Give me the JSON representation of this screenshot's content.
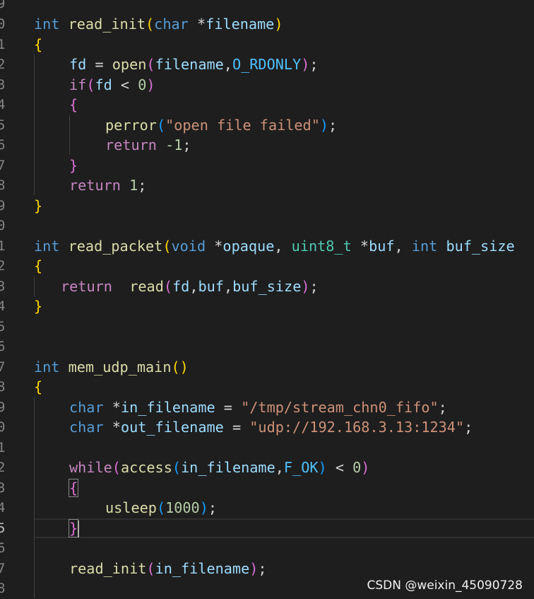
{
  "editor": {
    "gutter_numbers": [
      "9",
      "0",
      "1",
      "2",
      "3",
      "4",
      "5",
      "6",
      "7",
      "8",
      "9",
      "0",
      "1",
      "2",
      "3",
      "4",
      "5",
      "6",
      "7",
      "8",
      "9",
      "0",
      "1",
      "2",
      "3",
      "4",
      "5",
      "6",
      "7",
      "8"
    ],
    "active_line_number": "5"
  },
  "tokens": {
    "int": "int",
    "char": "char",
    "void": "void",
    "uint8_t": "uint8_t",
    "if": "if",
    "return": "return",
    "while": "while",
    "read_init": "read_init",
    "read_packet": "read_packet",
    "mem_udp_main": "mem_udp_main",
    "open": "open",
    "perror": "perror",
    "read": "read",
    "access": "access",
    "usleep": "usleep",
    "filename": "filename",
    "fd": "fd",
    "opaque": "opaque",
    "buf": "buf",
    "buf_size": "buf_size",
    "in_filename": "in_filename",
    "out_filename": "out_filename",
    "O_RDONLY": "O_RDONLY",
    "F_OK": "F_OK",
    "str_open_failed": "\"open file failed\"",
    "str_in_path": "\"/tmp/stream_chn0_fifo\"",
    "str_out_url": "\"udp://192.168.3.13:1234\"",
    "num_0": "0",
    "num_1": "1",
    "num_neg1": "-1",
    "num_1000": "1000"
  },
  "watermark": "CSDN @weixin_45090728"
}
